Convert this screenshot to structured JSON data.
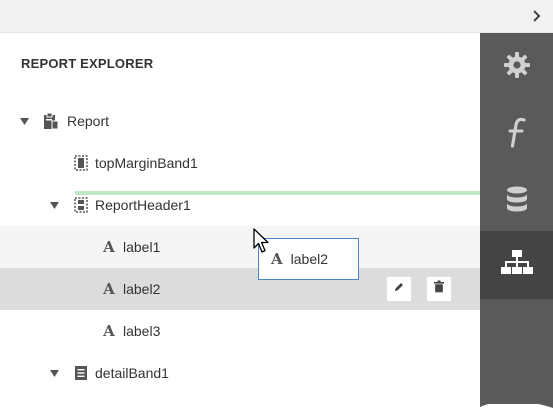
{
  "panel": {
    "title": "REPORT EXPLORER"
  },
  "tree": {
    "items": [
      {
        "label": "Report",
        "icon": "report-icon",
        "expanded": true
      },
      {
        "label": "topMarginBand1",
        "icon": "margin-band-icon"
      },
      {
        "label": "ReportHeader1",
        "icon": "report-header-icon",
        "expanded": true
      },
      {
        "label": "label1",
        "icon": "label-icon"
      },
      {
        "label": "label2",
        "icon": "label-icon",
        "selected": true
      },
      {
        "label": "label3",
        "icon": "label-icon"
      },
      {
        "label": "detailBand1",
        "icon": "detail-band-icon",
        "expanded": true
      }
    ]
  },
  "drag": {
    "label": "label2",
    "icon": "label-icon"
  },
  "row_actions": {
    "edit": "pencil-icon",
    "delete": "trash-icon"
  },
  "sidebar": {
    "tabs": [
      {
        "name": "properties",
        "icon": "gear-icon"
      },
      {
        "name": "expressions",
        "icon": "function-icon"
      },
      {
        "name": "field-list",
        "icon": "database-icon"
      },
      {
        "name": "report-explorer",
        "icon": "hierarchy-icon",
        "active": true
      }
    ]
  },
  "colors": {
    "sidebar_bg": "#5a5a5a",
    "sidebar_active": "#444444",
    "selected_row": "#dcdcdc",
    "drop_indicator": "#bfe8c8",
    "drag_border": "#4a86c5"
  }
}
